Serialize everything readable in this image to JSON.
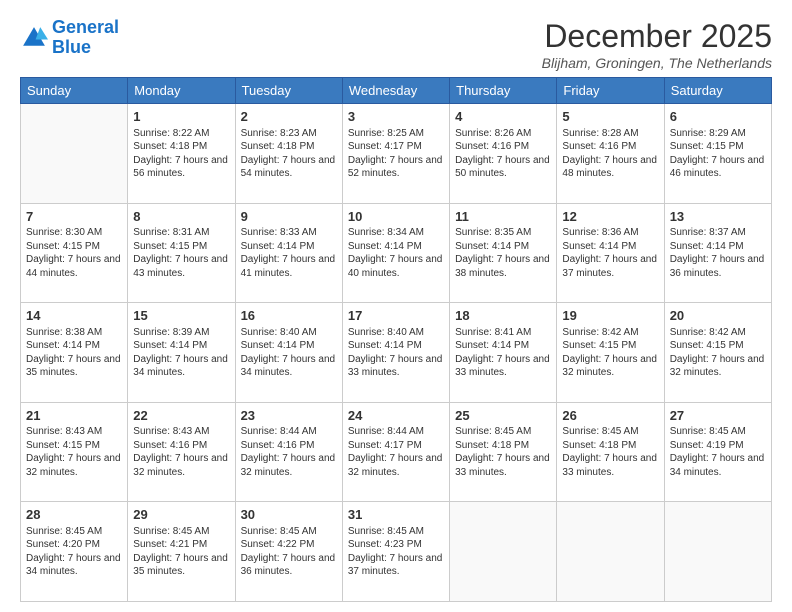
{
  "logo": {
    "line1": "General",
    "line2": "Blue"
  },
  "title": "December 2025",
  "location": "Blijham, Groningen, The Netherlands",
  "header_days": [
    "Sunday",
    "Monday",
    "Tuesday",
    "Wednesday",
    "Thursday",
    "Friday",
    "Saturday"
  ],
  "weeks": [
    [
      {
        "day": "",
        "sunrise": "",
        "sunset": "",
        "daylight": ""
      },
      {
        "day": "1",
        "sunrise": "Sunrise: 8:22 AM",
        "sunset": "Sunset: 4:18 PM",
        "daylight": "Daylight: 7 hours and 56 minutes."
      },
      {
        "day": "2",
        "sunrise": "Sunrise: 8:23 AM",
        "sunset": "Sunset: 4:18 PM",
        "daylight": "Daylight: 7 hours and 54 minutes."
      },
      {
        "day": "3",
        "sunrise": "Sunrise: 8:25 AM",
        "sunset": "Sunset: 4:17 PM",
        "daylight": "Daylight: 7 hours and 52 minutes."
      },
      {
        "day": "4",
        "sunrise": "Sunrise: 8:26 AM",
        "sunset": "Sunset: 4:16 PM",
        "daylight": "Daylight: 7 hours and 50 minutes."
      },
      {
        "day": "5",
        "sunrise": "Sunrise: 8:28 AM",
        "sunset": "Sunset: 4:16 PM",
        "daylight": "Daylight: 7 hours and 48 minutes."
      },
      {
        "day": "6",
        "sunrise": "Sunrise: 8:29 AM",
        "sunset": "Sunset: 4:15 PM",
        "daylight": "Daylight: 7 hours and 46 minutes."
      }
    ],
    [
      {
        "day": "7",
        "sunrise": "Sunrise: 8:30 AM",
        "sunset": "Sunset: 4:15 PM",
        "daylight": "Daylight: 7 hours and 44 minutes."
      },
      {
        "day": "8",
        "sunrise": "Sunrise: 8:31 AM",
        "sunset": "Sunset: 4:15 PM",
        "daylight": "Daylight: 7 hours and 43 minutes."
      },
      {
        "day": "9",
        "sunrise": "Sunrise: 8:33 AM",
        "sunset": "Sunset: 4:14 PM",
        "daylight": "Daylight: 7 hours and 41 minutes."
      },
      {
        "day": "10",
        "sunrise": "Sunrise: 8:34 AM",
        "sunset": "Sunset: 4:14 PM",
        "daylight": "Daylight: 7 hours and 40 minutes."
      },
      {
        "day": "11",
        "sunrise": "Sunrise: 8:35 AM",
        "sunset": "Sunset: 4:14 PM",
        "daylight": "Daylight: 7 hours and 38 minutes."
      },
      {
        "day": "12",
        "sunrise": "Sunrise: 8:36 AM",
        "sunset": "Sunset: 4:14 PM",
        "daylight": "Daylight: 7 hours and 37 minutes."
      },
      {
        "day": "13",
        "sunrise": "Sunrise: 8:37 AM",
        "sunset": "Sunset: 4:14 PM",
        "daylight": "Daylight: 7 hours and 36 minutes."
      }
    ],
    [
      {
        "day": "14",
        "sunrise": "Sunrise: 8:38 AM",
        "sunset": "Sunset: 4:14 PM",
        "daylight": "Daylight: 7 hours and 35 minutes."
      },
      {
        "day": "15",
        "sunrise": "Sunrise: 8:39 AM",
        "sunset": "Sunset: 4:14 PM",
        "daylight": "Daylight: 7 hours and 34 minutes."
      },
      {
        "day": "16",
        "sunrise": "Sunrise: 8:40 AM",
        "sunset": "Sunset: 4:14 PM",
        "daylight": "Daylight: 7 hours and 34 minutes."
      },
      {
        "day": "17",
        "sunrise": "Sunrise: 8:40 AM",
        "sunset": "Sunset: 4:14 PM",
        "daylight": "Daylight: 7 hours and 33 minutes."
      },
      {
        "day": "18",
        "sunrise": "Sunrise: 8:41 AM",
        "sunset": "Sunset: 4:14 PM",
        "daylight": "Daylight: 7 hours and 33 minutes."
      },
      {
        "day": "19",
        "sunrise": "Sunrise: 8:42 AM",
        "sunset": "Sunset: 4:15 PM",
        "daylight": "Daylight: 7 hours and 32 minutes."
      },
      {
        "day": "20",
        "sunrise": "Sunrise: 8:42 AM",
        "sunset": "Sunset: 4:15 PM",
        "daylight": "Daylight: 7 hours and 32 minutes."
      }
    ],
    [
      {
        "day": "21",
        "sunrise": "Sunrise: 8:43 AM",
        "sunset": "Sunset: 4:15 PM",
        "daylight": "Daylight: 7 hours and 32 minutes."
      },
      {
        "day": "22",
        "sunrise": "Sunrise: 8:43 AM",
        "sunset": "Sunset: 4:16 PM",
        "daylight": "Daylight: 7 hours and 32 minutes."
      },
      {
        "day": "23",
        "sunrise": "Sunrise: 8:44 AM",
        "sunset": "Sunset: 4:16 PM",
        "daylight": "Daylight: 7 hours and 32 minutes."
      },
      {
        "day": "24",
        "sunrise": "Sunrise: 8:44 AM",
        "sunset": "Sunset: 4:17 PM",
        "daylight": "Daylight: 7 hours and 32 minutes."
      },
      {
        "day": "25",
        "sunrise": "Sunrise: 8:45 AM",
        "sunset": "Sunset: 4:18 PM",
        "daylight": "Daylight: 7 hours and 33 minutes."
      },
      {
        "day": "26",
        "sunrise": "Sunrise: 8:45 AM",
        "sunset": "Sunset: 4:18 PM",
        "daylight": "Daylight: 7 hours and 33 minutes."
      },
      {
        "day": "27",
        "sunrise": "Sunrise: 8:45 AM",
        "sunset": "Sunset: 4:19 PM",
        "daylight": "Daylight: 7 hours and 34 minutes."
      }
    ],
    [
      {
        "day": "28",
        "sunrise": "Sunrise: 8:45 AM",
        "sunset": "Sunset: 4:20 PM",
        "daylight": "Daylight: 7 hours and 34 minutes."
      },
      {
        "day": "29",
        "sunrise": "Sunrise: 8:45 AM",
        "sunset": "Sunset: 4:21 PM",
        "daylight": "Daylight: 7 hours and 35 minutes."
      },
      {
        "day": "30",
        "sunrise": "Sunrise: 8:45 AM",
        "sunset": "Sunset: 4:22 PM",
        "daylight": "Daylight: 7 hours and 36 minutes."
      },
      {
        "day": "31",
        "sunrise": "Sunrise: 8:45 AM",
        "sunset": "Sunset: 4:23 PM",
        "daylight": "Daylight: 7 hours and 37 minutes."
      },
      {
        "day": "",
        "sunrise": "",
        "sunset": "",
        "daylight": ""
      },
      {
        "day": "",
        "sunrise": "",
        "sunset": "",
        "daylight": ""
      },
      {
        "day": "",
        "sunrise": "",
        "sunset": "",
        "daylight": ""
      }
    ]
  ]
}
